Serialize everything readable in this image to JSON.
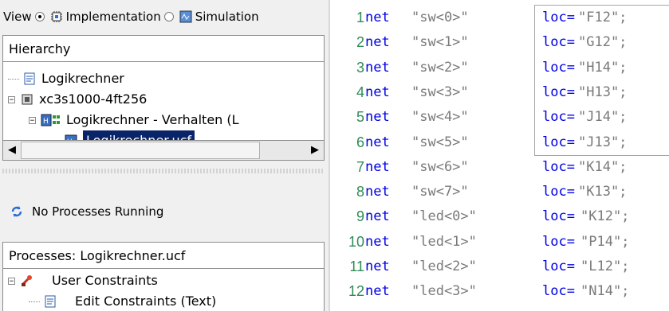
{
  "viewbar": {
    "view_label": "View",
    "opt1_label": "Implementation",
    "opt2_label": "Simulation"
  },
  "hierarchy": {
    "title": "Hierarchy",
    "items": [
      {
        "label": "Logikrechner"
      },
      {
        "label": "xc3s1000-4ft256"
      },
      {
        "label": "Logikrechner - Verhalten (L"
      },
      {
        "label": "Logikrechner.ucf"
      }
    ]
  },
  "status": {
    "text": "No Processes Running"
  },
  "processes": {
    "title": "Processes: Logikrechner.ucf",
    "items": [
      {
        "label": "User Constraints"
      },
      {
        "label": "Edit Constraints (Text)"
      }
    ]
  },
  "editor": {
    "lines": [
      {
        "n": "1",
        "kw": "net",
        "sig": "\"sw<0>\"",
        "loc": "loc=",
        "val": "\"F12\";"
      },
      {
        "n": "2",
        "kw": "net",
        "sig": "\"sw<1>\"",
        "loc": "loc=",
        "val": "\"G12\";"
      },
      {
        "n": "3",
        "kw": "net",
        "sig": "\"sw<2>\"",
        "loc": "loc=",
        "val": "\"H14\";"
      },
      {
        "n": "4",
        "kw": "net",
        "sig": "\"sw<3>\"",
        "loc": "loc=",
        "val": "\"H13\";"
      },
      {
        "n": "5",
        "kw": "net",
        "sig": "\"sw<4>\"",
        "loc": "loc=",
        "val": "\"J14\";"
      },
      {
        "n": "6",
        "kw": "net",
        "sig": "\"sw<5>\"",
        "loc": "loc=",
        "val": "\"J13\";"
      },
      {
        "n": "7",
        "kw": "net",
        "sig": "\"sw<6>\"",
        "loc": "loc=",
        "val": "\"K14\";"
      },
      {
        "n": "8",
        "kw": "net",
        "sig": "\"sw<7>\"",
        "loc": "loc=",
        "val": "\"K13\";"
      },
      {
        "n": "9",
        "kw": "net",
        "sig": "\"led<0>\"",
        "loc": "loc=",
        "val": "\"K12\";"
      },
      {
        "n": "10",
        "kw": "net",
        "sig": "\"led<1>\"",
        "loc": "loc=",
        "val": "\"P14\";"
      },
      {
        "n": "11",
        "kw": "net",
        "sig": "\"led<2>\"",
        "loc": "loc=",
        "val": "\"L12\";"
      },
      {
        "n": "12",
        "kw": "net",
        "sig": "\"led<3>\"",
        "loc": "loc=",
        "val": "\"N14\";"
      }
    ]
  }
}
